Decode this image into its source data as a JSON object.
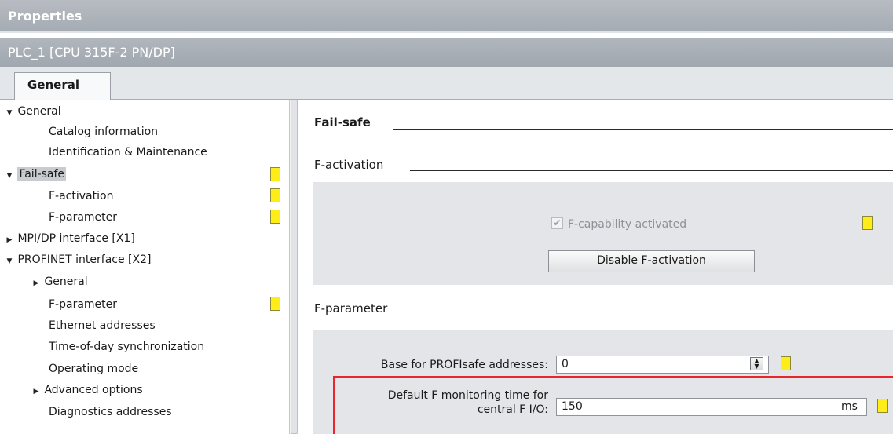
{
  "window": {
    "title": "Properties",
    "object": "PLC_1 [CPU 315F-2 PN/DP]"
  },
  "tabs": [
    {
      "label": "General"
    }
  ],
  "nav": {
    "items": [
      {
        "label": "General",
        "expander": "▼",
        "level": 0
      },
      {
        "label": "Catalog information",
        "expander": "",
        "level": 2
      },
      {
        "label": "Identification & Maintenance",
        "expander": "",
        "level": 2
      },
      {
        "label": "Fail-safe",
        "expander": "▼",
        "level": 0,
        "selected": true
      },
      {
        "label": "F-activation",
        "expander": "",
        "level": 2
      },
      {
        "label": "F-parameter",
        "expander": "",
        "level": 2
      },
      {
        "label": "MPI/DP interface [X1]",
        "expander": "▶",
        "level": 0
      },
      {
        "label": "PROFINET interface [X2]",
        "expander": "▼",
        "level": 0
      },
      {
        "label": "General",
        "expander": "▶",
        "level": 1
      },
      {
        "label": "F-parameter",
        "expander": "",
        "level": 2
      },
      {
        "label": "Ethernet addresses",
        "expander": "",
        "level": 2
      },
      {
        "label": "Time-of-day synchronization",
        "expander": "",
        "level": 2
      },
      {
        "label": "Operating mode",
        "expander": "",
        "level": 2
      },
      {
        "label": "Advanced options",
        "expander": "▶",
        "level": 1
      },
      {
        "label": "Diagnostics addresses",
        "expander": "",
        "level": 2
      }
    ]
  },
  "content": {
    "section_title": "Fail-safe",
    "f_activation": {
      "heading": "F-activation",
      "checkbox_label": "F-capability activated",
      "checkbox_checked": true,
      "checkbox_mark": "✔",
      "button_label": "Disable F-activation"
    },
    "f_parameter": {
      "heading": "F-parameter",
      "base_label": "Base for PROFIsafe addresses:",
      "base_value": "0",
      "monitoring_label_1": "Default F monitoring time for",
      "monitoring_label_2": "central F I/O:",
      "monitoring_value": "150",
      "monitoring_unit": "ms"
    }
  },
  "colors": {
    "marker": "#ffed1a",
    "highlight": "#e8262b",
    "header_bar": "#a6acb3",
    "panel": "#e3e5e8"
  }
}
